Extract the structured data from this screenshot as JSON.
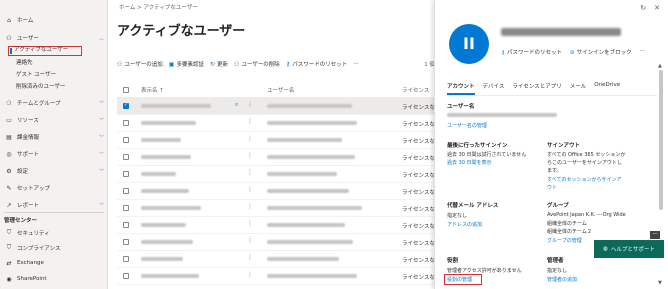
{
  "sidebar": {
    "items": [
      {
        "icon": "home-icon",
        "label": "ホーム"
      },
      {
        "icon": "user-icon",
        "label": "ユーザー"
      }
    ],
    "sub_items": [
      "アクティブなユーザー",
      "連絡先",
      "ゲスト ユーザー",
      "削除済みのユーザー"
    ],
    "items2": [
      {
        "icon": "team-icon",
        "label": "チームとグループ"
      },
      {
        "icon": "resources-icon",
        "label": "リソース"
      },
      {
        "icon": "billing-icon",
        "label": "課金情報"
      },
      {
        "icon": "support-icon",
        "label": "サポート"
      },
      {
        "icon": "settings-icon",
        "label": "設定"
      },
      {
        "icon": "setup-icon",
        "label": "セットアップ"
      },
      {
        "icon": "reports-icon",
        "label": "レポート"
      }
    ],
    "admin_center_title": "管理センター",
    "admin_items": [
      {
        "icon": "security-icon",
        "label": "セキュリティ"
      },
      {
        "icon": "compliance-icon",
        "label": "コンプライアンス"
      },
      {
        "icon": "exchange-icon",
        "label": "Exchange"
      },
      {
        "icon": "sharepoint-icon",
        "label": "SharePoint"
      }
    ]
  },
  "main": {
    "breadcrumb": "ホーム  >  アクティブなユーザー",
    "title": "アクティブなユーザー",
    "toolbar": [
      {
        "icon": "add-user-icon",
        "label": "ユーザーの追加"
      },
      {
        "icon": "mfa-icon",
        "label": "多要素認証"
      },
      {
        "icon": "refresh-icon",
        "label": "更新"
      },
      {
        "icon": "delete-user-icon",
        "label": "ユーザーの削除"
      },
      {
        "icon": "key-icon",
        "label": "パスワードのリセット"
      },
      {
        "icon": "more-icon",
        "label": "···"
      }
    ],
    "toolbar_right": "1 個",
    "columns": {
      "display_name": "表示名 ↑",
      "username": "ユーザー名",
      "license": "ライセンス"
    },
    "license_text": "ライセンスなし"
  },
  "panel": {
    "avatar_initials": "II",
    "actions": [
      {
        "icon": "key-icon",
        "label": "パスワードのリセット"
      },
      {
        "icon": "block-icon",
        "label": "サインインをブロック"
      },
      {
        "icon": "more-icon",
        "label": "···"
      }
    ],
    "tabs": [
      "アカウント",
      "デバイス",
      "ライセンスとアプリ",
      "メール",
      "OneDrive"
    ],
    "username_label": "ユーザー名",
    "username_link": "ユーザー名の管理",
    "last_signin_label": "最後に行ったサインイン",
    "last_signin_text": "過去 30 日間は試行されていません",
    "last_signin_link": "過去 30 日間を表示",
    "signout_label": "サインアウト",
    "signout_text1": "すべての Office 365 セッションか",
    "signout_text2": "らこのユーザーをサインアウトし",
    "signout_text3": "ます。",
    "signout_link1": "すべてのセッションからサインア",
    "signout_link2": "ウト",
    "alias_label": "代替メール アドレス",
    "alias_text": "指定なし",
    "alias_link": "アドレスの追加",
    "groups_label": "グループ",
    "groups_text1": "AvePoint Japan K.K. ---Org Wide",
    "groups_text2": "組織全体のチーム",
    "groups_text3": "組織全体のチーム２",
    "groups_link": "グループの管理",
    "roles_label": "役割",
    "roles_text": "管理者アクセス許可がありません",
    "roles_link": "役割の管理",
    "manager_label": "管理者",
    "manager_text": "指定なし",
    "manager_link": "管理者の追加",
    "help_label": "ヘルプとサポート"
  }
}
